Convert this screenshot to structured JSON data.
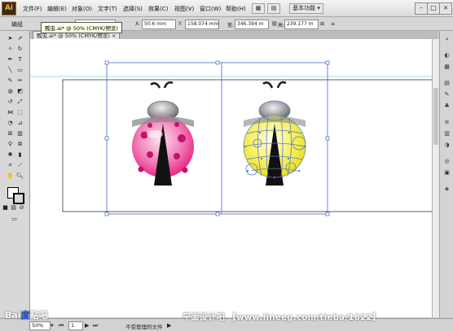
{
  "app": {
    "logo_text": "Ai"
  },
  "menubar": {
    "items": [
      "文件(F)",
      "编辑(E)",
      "对象(O)",
      "文字(T)",
      "选择(S)",
      "效果(C)",
      "视图(V)",
      "窗口(W)",
      "帮助(H)"
    ],
    "workspace_label": "基本功能",
    "window_controls": [
      "–",
      "□",
      "×"
    ]
  },
  "controlbar": {
    "selection_label": "编组",
    "x_value": "50.6 mm",
    "y_value": "158.074 mm",
    "w_value": "346.394 m",
    "h_value": "239.177 m"
  },
  "tooltip": {
    "text": "瓢虫.ai* @ 50% (CMYK/预览)"
  },
  "document_tab": {
    "label": "瓢虫.ai* @ 50% (CMYK/预览)"
  },
  "statusbar": {
    "zoom": "50%",
    "page": "1",
    "status_text": "不受管理的文件"
  },
  "watermarks": {
    "baidu": "Bai",
    "baidu_paw": "度",
    "baidu_tieba": "贴吧",
    "site": "平面设计吧 【www.lineeg.com/tieba/1822】"
  },
  "colors": {
    "ladybug_pink": "#e8197a",
    "ladybug_yellow": "#f4ee1a",
    "selection_blue": "#5a78c8",
    "head_gray": "#7a7a7a"
  }
}
